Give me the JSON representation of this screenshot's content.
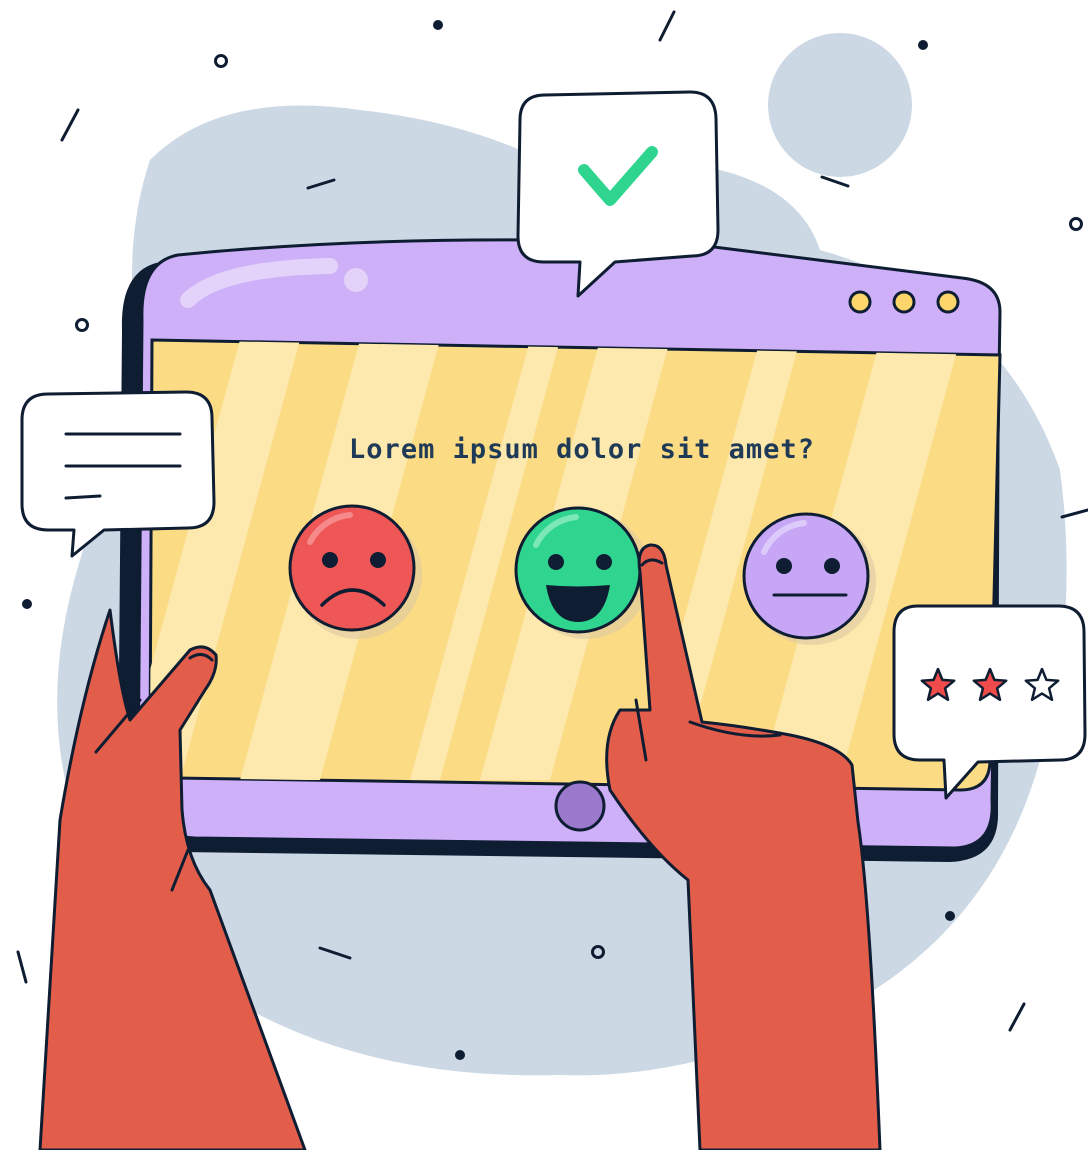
{
  "survey": {
    "question": "Lorem ipsum dolor sit amet?",
    "options": [
      {
        "mood": "sad",
        "icon": "sad-face-icon"
      },
      {
        "mood": "happy",
        "icon": "happy-face-icon"
      },
      {
        "mood": "neutral",
        "icon": "neutral-face-icon"
      }
    ],
    "selected": "happy"
  },
  "rating": {
    "stars_filled": 2,
    "stars_total": 3
  },
  "icons": [
    "checkmark-icon",
    "text-message-icon",
    "star-icon",
    "home-button-icon",
    "window-dots-icon"
  ],
  "colors": {
    "outline": "#0f1d33",
    "background_blob": "#cdd8e5",
    "tablet_frame": "#cdb0f7",
    "screen": "#fcdb85",
    "screen_stripe": "#fde8ae",
    "dot_yellow": "#fcd66a",
    "home_button": "#9b79cc",
    "sad_face": "#ef5656",
    "happy_face": "#2fd58f",
    "neutral_face": "#c6a6f5",
    "check": "#2fd58f",
    "star": "#ef4b4b",
    "hand": "#e35e4a",
    "question_text": "#1f3a57"
  }
}
